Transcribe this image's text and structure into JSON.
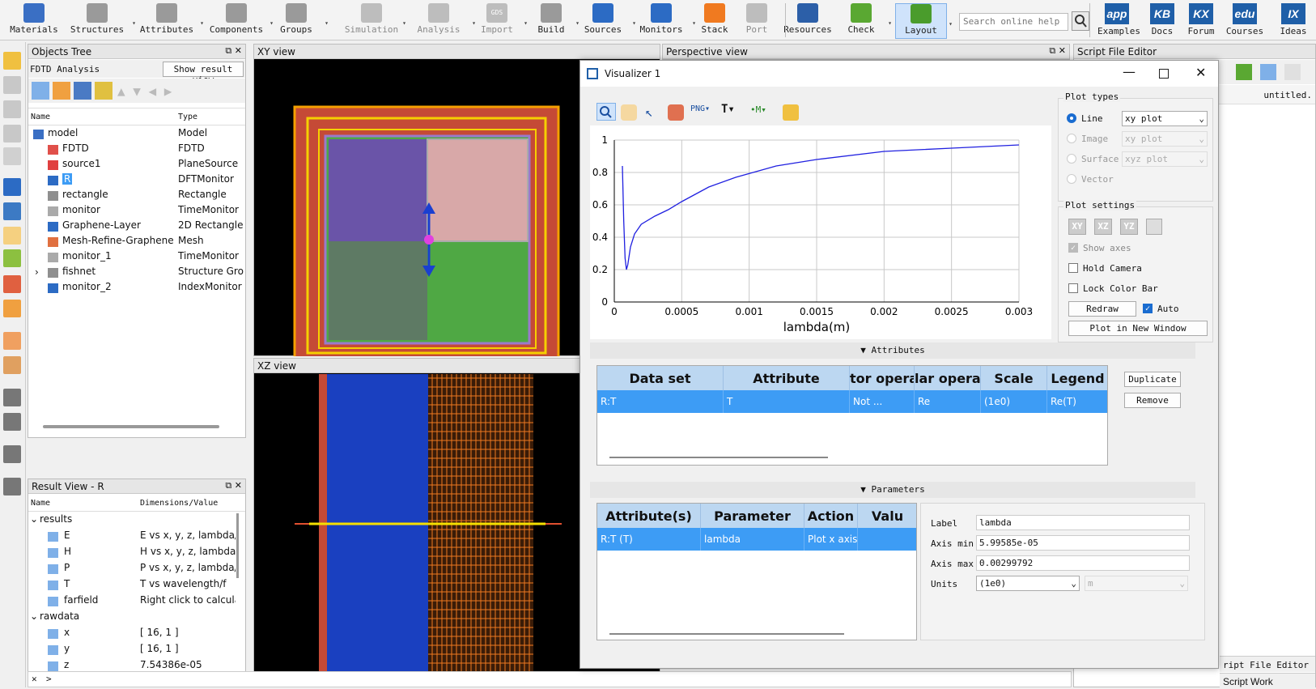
{
  "toolbar": {
    "items": [
      {
        "label": "Materials",
        "icon": "materials-icon",
        "color": "#3a6fc4"
      },
      {
        "label": "Structures",
        "icon": "structures-icon",
        "color": "#9a9a9a"
      },
      {
        "label": "Attributes",
        "icon": "attributes-icon",
        "color": "#9a9a9a"
      },
      {
        "label": "Components",
        "icon": "components-icon",
        "color": "#9a9a9a"
      },
      {
        "label": "Groups",
        "icon": "groups-icon",
        "color": "#9a9a9a"
      },
      {
        "label": "Simulation",
        "icon": "simulation-icon",
        "color": "#bdbdbd"
      },
      {
        "label": "Analysis",
        "icon": "analysis-icon",
        "color": "#bdbdbd"
      },
      {
        "label": "Import",
        "icon": "gds-import-icon",
        "color": "#bdbdbd",
        "text": "GDS"
      },
      {
        "label": "Build",
        "icon": "build-icon",
        "color": "#9a9a9a"
      },
      {
        "label": "Sources",
        "icon": "sources-globe-icon",
        "color": "#2c6bc4"
      },
      {
        "label": "Monitors",
        "icon": "monitors-globe-icon",
        "color": "#2c6bc4"
      },
      {
        "label": "Stack",
        "icon": "stack-icon",
        "color": "#f07a20"
      },
      {
        "label": "Port",
        "icon": "port-icon",
        "color": "#bdbdbd"
      },
      {
        "label": "Resources",
        "icon": "resources-icon",
        "color": "#2c5fa8"
      },
      {
        "label": "Check",
        "icon": "check-icon",
        "color": "#5aa832"
      },
      {
        "label": "Layout",
        "icon": "layout-icon",
        "color": "#4a9c2c"
      }
    ],
    "search_placeholder": "Search online help",
    "links": [
      {
        "label": "Examples",
        "text": "app"
      },
      {
        "label": "Docs",
        "text": "KB"
      },
      {
        "label": "Forum",
        "text": "KX"
      },
      {
        "label": "Courses",
        "text": "edu"
      },
      {
        "label": "Ideas",
        "text": "IX"
      }
    ]
  },
  "objects_tree": {
    "title": "Objects Tree",
    "analysis_label": "FDTD Analysis",
    "result_view_button": "Show result view",
    "col_name": "Name",
    "col_type": "Type",
    "items": [
      {
        "name": "model",
        "type": "Model",
        "color": "#3a6fc4"
      },
      {
        "name": "FDTD",
        "type": "FDTD",
        "color": "#e0504a"
      },
      {
        "name": "source1",
        "type": "PlaneSource",
        "color": "#e04040"
      },
      {
        "name": "R",
        "type": "DFTMonitor",
        "color": "#2c6bc4"
      },
      {
        "name": "rectangle",
        "type": "Rectangle",
        "color": "#8f8f8f"
      },
      {
        "name": "monitor",
        "type": "TimeMonitor",
        "color": "#aaaaaa"
      },
      {
        "name": "Graphene-Layer",
        "type": "2D Rectangle",
        "color": "#2c6bc4"
      },
      {
        "name": "Mesh-Refine-Graphene",
        "type": "Mesh",
        "color": "#e07040"
      },
      {
        "name": "monitor_1",
        "type": "TimeMonitor",
        "color": "#aaaaaa"
      },
      {
        "name": "fishnet",
        "type": "Structure Gro",
        "color": "#8f8f8f"
      },
      {
        "name": "monitor_2",
        "type": "IndexMonitor",
        "color": "#2c6bc4"
      }
    ]
  },
  "result_view": {
    "title": "Result View - R",
    "col_name": "Name",
    "col_value": "Dimensions/Value",
    "groups": [
      {
        "name": "results",
        "items": [
          {
            "name": "E",
            "value": "E vs x, y, z, lambda/"
          },
          {
            "name": "H",
            "value": "H vs x, y, z, lambda/"
          },
          {
            "name": "P",
            "value": "P vs x, y, z, lambda/"
          },
          {
            "name": "T",
            "value": "T vs wavelength/f"
          },
          {
            "name": "farfield",
            "value": "Right click to calcula"
          }
        ]
      },
      {
        "name": "rawdata",
        "items": [
          {
            "name": "x",
            "value": "[ 16, 1 ]"
          },
          {
            "name": "y",
            "value": "[ 16, 1 ]"
          },
          {
            "name": "z",
            "value": "7.54386e-05"
          }
        ]
      }
    ]
  },
  "views": {
    "xy": "XY view",
    "xz": "XZ view",
    "perspective": "Perspective view",
    "script_editor": "Script File Editor",
    "script_tab": "untitled.",
    "script_editor_bottom": "ript File Editor",
    "script_workspace": "Script Work"
  },
  "visualizer": {
    "title": "Visualizer 1",
    "plot_types": {
      "title": "Plot types",
      "options": [
        {
          "label": "Line",
          "value": "xy plot",
          "selected": true
        },
        {
          "label": "Image",
          "value": "xy plot",
          "selected": false
        },
        {
          "label": "Surface",
          "value": "xyz plot",
          "selected": false
        },
        {
          "label": "Vector",
          "value": "",
          "selected": false
        }
      ]
    },
    "plot_settings": {
      "title": "Plot settings",
      "buttons": [
        "XY",
        "XZ",
        "YZ"
      ],
      "show_axes": "Show axes",
      "hold_camera": "Hold Camera",
      "lock_color_bar": "Lock Color Bar",
      "redraw": "Redraw",
      "auto": "Auto",
      "new_window": "Plot in New Window"
    },
    "attributes": {
      "title": "Attributes",
      "headers": [
        "Data set",
        "Attribute",
        "tor operat",
        "lar operat",
        "Scale",
        "Legend"
      ],
      "row": [
        "R:T",
        "T",
        "Not ...",
        "Re",
        "(1e0)",
        "Re(T)"
      ],
      "duplicate": "Duplicate",
      "remove": "Remove"
    },
    "parameters": {
      "title": "Parameters",
      "headers": [
        "Attribute(s)",
        "Parameter",
        "Action",
        "Valu"
      ],
      "row": [
        "R:T (T)",
        "lambda",
        "Plot x axis",
        ""
      ],
      "label_label": "Label",
      "label_value": "lambda",
      "axis_min_label": "Axis min",
      "axis_min": "5.99585e-05",
      "axis_max_label": "Axis max",
      "axis_max": "0.00299792",
      "units_label": "Units",
      "units": "(1e0)",
      "units2": "m"
    }
  },
  "chart_data": {
    "type": "line",
    "xlabel": "lambda(m)",
    "ylabel": "",
    "xlim": [
      0,
      0.003
    ],
    "ylim": [
      0,
      1
    ],
    "xticks": [
      "0",
      "0.0005",
      "0.001",
      "0.0015",
      "0.002",
      "0.0025",
      "0.003"
    ],
    "yticks": [
      "0",
      "0.2",
      "0.4",
      "0.6",
      "0.8",
      "1"
    ],
    "series": [
      {
        "color": "#2020e0",
        "x": [
          6e-05,
          7e-05,
          8e-05,
          9e-05,
          0.0001,
          0.00012,
          0.00015,
          0.0002,
          0.0003,
          0.0004,
          0.0005,
          0.0007,
          0.0009,
          0.0012,
          0.0015,
          0.002,
          0.0025,
          0.003
        ],
        "y": [
          0.84,
          0.5,
          0.27,
          0.2,
          0.23,
          0.34,
          0.42,
          0.48,
          0.53,
          0.57,
          0.62,
          0.71,
          0.77,
          0.84,
          0.88,
          0.93,
          0.95,
          0.97
        ]
      }
    ]
  }
}
